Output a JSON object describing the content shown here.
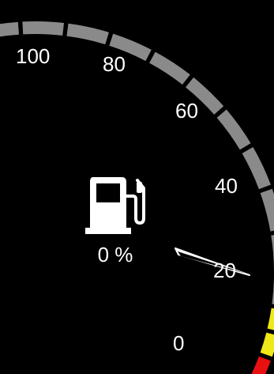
{
  "gauge": {
    "type": "fuel-gauge",
    "value_percent": 0,
    "readout_text": "0 %",
    "scale_max": 100,
    "tick_labels": [
      "100",
      "80",
      "60",
      "40",
      "20",
      "0"
    ],
    "needle_indicates_scale": 20,
    "colors": {
      "background": "#000000",
      "track": "#8a8a8a",
      "warning": "#f0e818",
      "critical": "#e81010",
      "needle": "#ffffff",
      "text": "#ffffff"
    },
    "icon": "fuel-pump-icon"
  }
}
